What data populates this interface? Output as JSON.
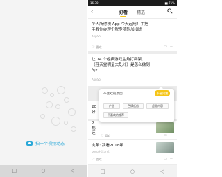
{
  "left_screen": {
    "post_label": "拍一个视频动态",
    "nav": [
      "□",
      "○",
      "◁"
    ]
  },
  "right_screen": {
    "status_time": "16:30",
    "status_right": "▮▮ 71%",
    "header": {
      "back": "‹",
      "tabs": [
        "好看",
        "精选"
      ]
    },
    "cards": [
      {
        "title_lines": [
          "个人所得税 App 今天起用！手把",
          "手教你办理个税专项附加扣除"
        ],
        "source": "AppSo",
        "meta": "喜欢",
        "actions": [
          "▭",
          "⋯"
        ]
      },
      {
        "title_lines": [
          "让 74 个经典游戏主角打群架,",
          "《任天堂明星大乱斗》是怎么做到",
          "的?"
        ],
        "source": "AppSo",
        "meta": "",
        "actions": []
      },
      {
        "title_lines": [
          "20",
          "分"
        ],
        "source": "",
        "meta": "",
        "actions": []
      },
      {
        "title_lines": [
          "2",
          "视",
          "还"
        ],
        "source": "",
        "meta": "喜欢",
        "actions": [
          "▭",
          "⋯"
        ]
      },
      {
        "title_lines": [
          "灾年: 我看2018年"
        ],
        "source": "bosu生活方式",
        "meta": "喜欢",
        "actions": [
          "▭",
          "⋯"
        ]
      }
    ],
    "popup": {
      "title": "不喜欢的原因",
      "button": "不感兴趣",
      "chips": [
        "广告",
        "色情低俗",
        "虚假内容",
        "不喜欢的推荐"
      ]
    },
    "nav": [
      "□",
      "○",
      "◁"
    ]
  }
}
